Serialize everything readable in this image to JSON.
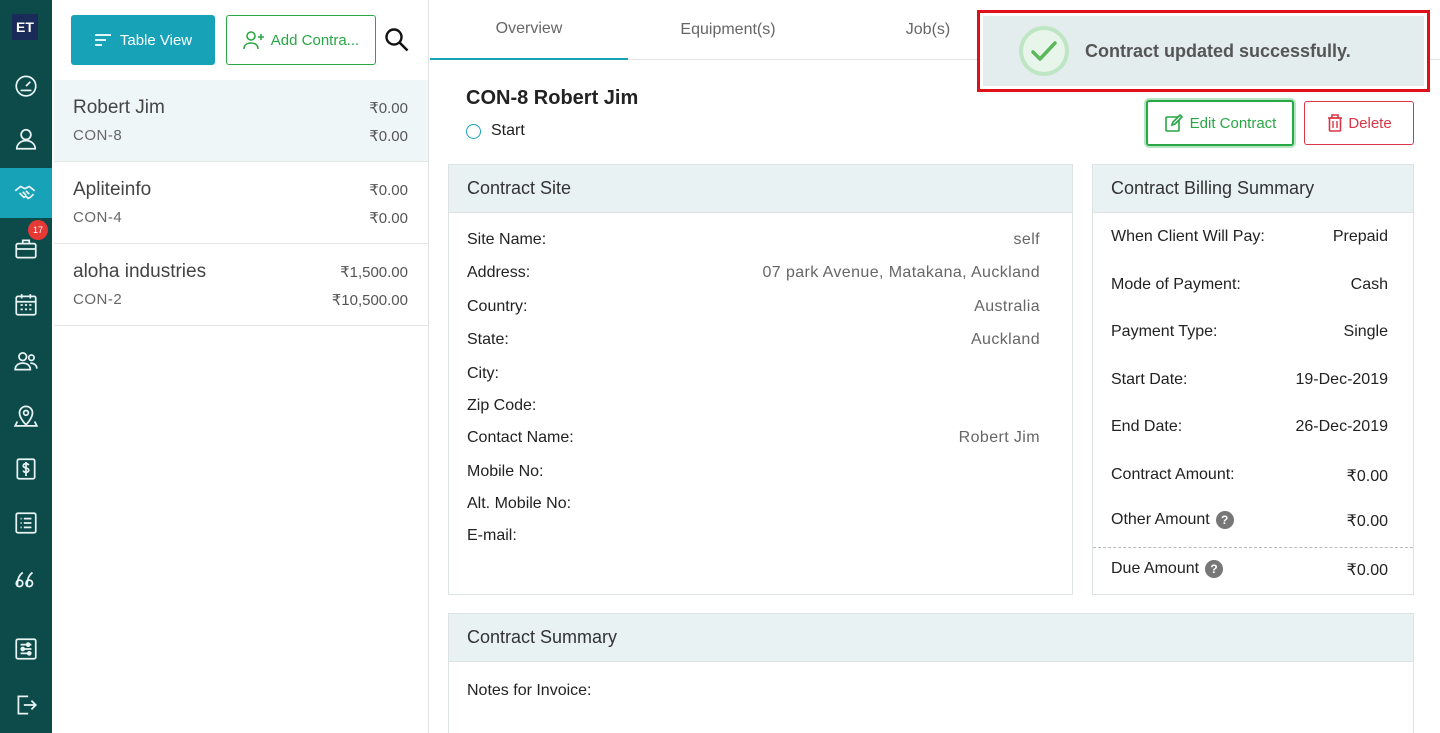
{
  "sidebar": {
    "logo": "ET",
    "badge_count": "17",
    "items": [
      {
        "icon": "dashboard-icon"
      },
      {
        "icon": "user-icon"
      },
      {
        "icon": "handshake-icon",
        "active": true
      },
      {
        "icon": "briefcase-icon"
      },
      {
        "icon": "calendar-icon"
      },
      {
        "icon": "users-icon"
      },
      {
        "icon": "map-pin-icon"
      },
      {
        "icon": "dollar-icon"
      },
      {
        "icon": "list-icon"
      },
      {
        "icon": "quote-icon"
      },
      {
        "icon": "settings-sliders-icon"
      },
      {
        "icon": "logout-icon"
      }
    ]
  },
  "toolbar": {
    "table_view_label": "Table View",
    "add_contract_label": "Add Contra..."
  },
  "contracts": [
    {
      "name": "Robert Jim",
      "code": "CON-8",
      "amount1": "₹0.00",
      "amount2": "₹0.00"
    },
    {
      "name": "Apliteinfo",
      "code": "CON-4",
      "amount1": "₹0.00",
      "amount2": "₹0.00"
    },
    {
      "name": "aloha industries",
      "code": "CON-2",
      "amount1": "₹1,500.00",
      "amount2": "₹10,500.00"
    }
  ],
  "tabs": [
    "Overview",
    "Equipment(s)",
    "Job(s)"
  ],
  "detail": {
    "title": "CON-8 Robert Jim",
    "status": "Start",
    "edit_label": "Edit Contract",
    "delete_label": "Delete"
  },
  "site": {
    "heading": "Contract Site",
    "rows": [
      {
        "label": "Site Name:",
        "value": "self"
      },
      {
        "label": "Address:",
        "value": "07 park Avenue, Matakana, Auckland"
      },
      {
        "label": "Country:",
        "value": "Australia"
      },
      {
        "label": "State:",
        "value": "Auckland"
      },
      {
        "label": "City:",
        "value": ""
      },
      {
        "label": "Zip Code:",
        "value": ""
      },
      {
        "label": "Contact Name:",
        "value": "Robert Jim"
      },
      {
        "label": "Mobile No:",
        "value": ""
      },
      {
        "label": "Alt. Mobile No:",
        "value": ""
      },
      {
        "label": "E-mail:",
        "value": ""
      }
    ]
  },
  "billing": {
    "heading": "Contract Billing Summary",
    "rows": [
      {
        "label": "When Client Will Pay:",
        "value": "Prepaid"
      },
      {
        "label": "Mode of Payment:",
        "value": "Cash"
      },
      {
        "label": "Payment Type:",
        "value": "Single"
      },
      {
        "label": "Start Date:",
        "value": "19-Dec-2019"
      },
      {
        "label": "End Date:",
        "value": "26-Dec-2019"
      },
      {
        "label": "Contract Amount:",
        "value": "₹0.00"
      },
      {
        "label": "Other Amount",
        "value": "₹0.00",
        "help": true
      },
      {
        "label": "Due Amount",
        "value": "₹0.00",
        "help": true
      }
    ]
  },
  "summary": {
    "heading": "Contract Summary",
    "notes_label": "Notes for Invoice:"
  },
  "toast": {
    "message": "Contract updated successfully."
  },
  "colors": {
    "sidebar": "#0d4a4a",
    "accent": "#17a2b8",
    "success": "#28a745",
    "danger": "#dc3545",
    "toast_border": "#e0101a"
  }
}
